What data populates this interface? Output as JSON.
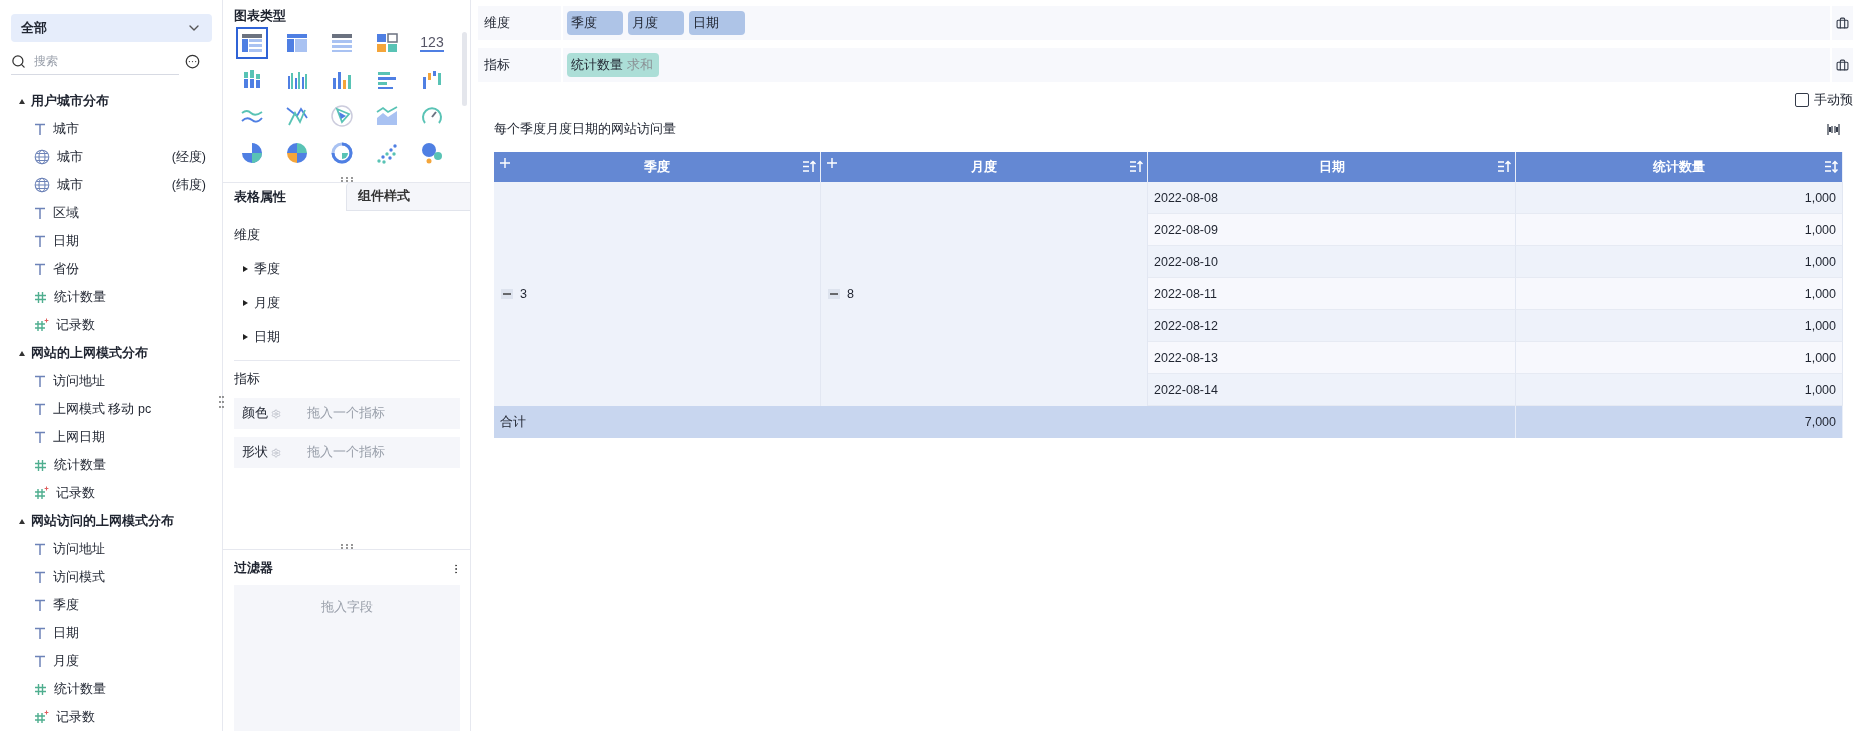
{
  "sidebar": {
    "dropdown": {
      "value": "全部"
    },
    "search": {
      "placeholder": "搜索"
    },
    "groups": [
      {
        "title": "用户城市分布",
        "expanded": true,
        "fields": [
          {
            "kind": "text",
            "name": "城市"
          },
          {
            "kind": "geo",
            "name": "城市",
            "suffix": "(经度)"
          },
          {
            "kind": "geo",
            "name": "城市",
            "suffix": "(纬度)"
          },
          {
            "kind": "text",
            "name": "区域"
          },
          {
            "kind": "text",
            "name": "日期"
          },
          {
            "kind": "text",
            "name": "省份"
          },
          {
            "kind": "measure",
            "name": "统计数量"
          },
          {
            "kind": "count",
            "name": "记录数"
          }
        ]
      },
      {
        "title": "网站的上网模式分布",
        "expanded": true,
        "fields": [
          {
            "kind": "text",
            "name": "访问地址"
          },
          {
            "kind": "text",
            "name": "上网模式 移动 pc"
          },
          {
            "kind": "text",
            "name": "上网日期"
          },
          {
            "kind": "measure",
            "name": "统计数量"
          },
          {
            "kind": "count",
            "name": "记录数"
          }
        ]
      },
      {
        "title": "网站访问的上网模式分布",
        "expanded": true,
        "fields": [
          {
            "kind": "text",
            "name": "访问地址"
          },
          {
            "kind": "text",
            "name": "访问模式"
          },
          {
            "kind": "text",
            "name": "季度"
          },
          {
            "kind": "text",
            "name": "日期"
          },
          {
            "kind": "text",
            "name": "月度"
          },
          {
            "kind": "measure",
            "name": "统计数量"
          },
          {
            "kind": "count",
            "name": "记录数"
          }
        ]
      }
    ]
  },
  "chart_panel": {
    "title": "图表类型",
    "chart_types": [
      {
        "kind": "table",
        "selected": true
      },
      {
        "kind": "pivot",
        "selected": false
      },
      {
        "kind": "detail",
        "selected": false
      },
      {
        "kind": "cards",
        "selected": false
      },
      {
        "kind": "number",
        "label": "123",
        "selected": false
      },
      {
        "kind": "stacked",
        "selected": false
      },
      {
        "kind": "grouped",
        "selected": false
      },
      {
        "kind": "bar",
        "selected": false
      },
      {
        "kind": "hbar",
        "selected": false
      },
      {
        "kind": "waterfall",
        "selected": false
      },
      {
        "kind": "line",
        "selected": false
      },
      {
        "kind": "cross",
        "selected": false
      },
      {
        "kind": "radar",
        "selected": false
      },
      {
        "kind": "area",
        "selected": false
      },
      {
        "kind": "gauge",
        "selected": false
      },
      {
        "kind": "pie",
        "selected": false
      },
      {
        "kind": "quarters",
        "selected": false
      },
      {
        "kind": "donut",
        "selected": false
      },
      {
        "kind": "scatter",
        "selected": false
      },
      {
        "kind": "bubble",
        "selected": false
      }
    ]
  },
  "property_tabs": [
    {
      "label": "表格属性",
      "selected": true
    },
    {
      "label": "组件样式",
      "selected": false
    }
  ],
  "dimensions_section": {
    "title": "维度",
    "items": [
      {
        "label": "季度",
        "expanded": false
      },
      {
        "label": "月度",
        "expanded": false
      },
      {
        "label": "日期",
        "expanded": false
      }
    ]
  },
  "measures_section": {
    "title": "指标",
    "slots": [
      {
        "label": "颜色",
        "placeholder": "拖入一个指标"
      },
      {
        "label": "形状",
        "placeholder": "拖入一个指标"
      }
    ]
  },
  "filter": {
    "title": "过滤器",
    "placeholder": "拖入字段"
  },
  "shelves": [
    {
      "label": "维度",
      "chips": [
        {
          "kind": "dimension",
          "name": "季度"
        },
        {
          "kind": "dimension",
          "name": "月度"
        },
        {
          "kind": "dimension",
          "name": "日期"
        }
      ]
    },
    {
      "label": "指标",
      "chips": [
        {
          "kind": "measure",
          "name": "统计数量",
          "aggregation": "求和"
        }
      ]
    }
  ],
  "manual_preview": {
    "label": "手动预",
    "checked": false
  },
  "table": {
    "title": "每个季度月度日期的网站访问量",
    "columns": [
      {
        "label": "季度",
        "expandable": true,
        "bidirectional_sort": false
      },
      {
        "label": "月度",
        "expandable": true,
        "bidirectional_sort": false
      },
      {
        "label": "日期",
        "expandable": false,
        "bidirectional_sort": false
      },
      {
        "label": "统计数量",
        "expandable": false,
        "bidirectional_sort": true
      }
    ],
    "merged": [
      {
        "value": "3",
        "expanded": true
      },
      {
        "value": "8",
        "expanded": true
      }
    ],
    "rows": [
      {
        "date": "2022-08-08",
        "count": "1,000"
      },
      {
        "date": "2022-08-09",
        "count": "1,000"
      },
      {
        "date": "2022-08-10",
        "count": "1,000"
      },
      {
        "date": "2022-08-11",
        "count": "1,000"
      },
      {
        "date": "2022-08-12",
        "count": "1,000"
      },
      {
        "date": "2022-08-13",
        "count": "1,000"
      },
      {
        "date": "2022-08-14",
        "count": "1,000"
      }
    ],
    "total": {
      "label": "合计",
      "value": "7,000"
    }
  }
}
